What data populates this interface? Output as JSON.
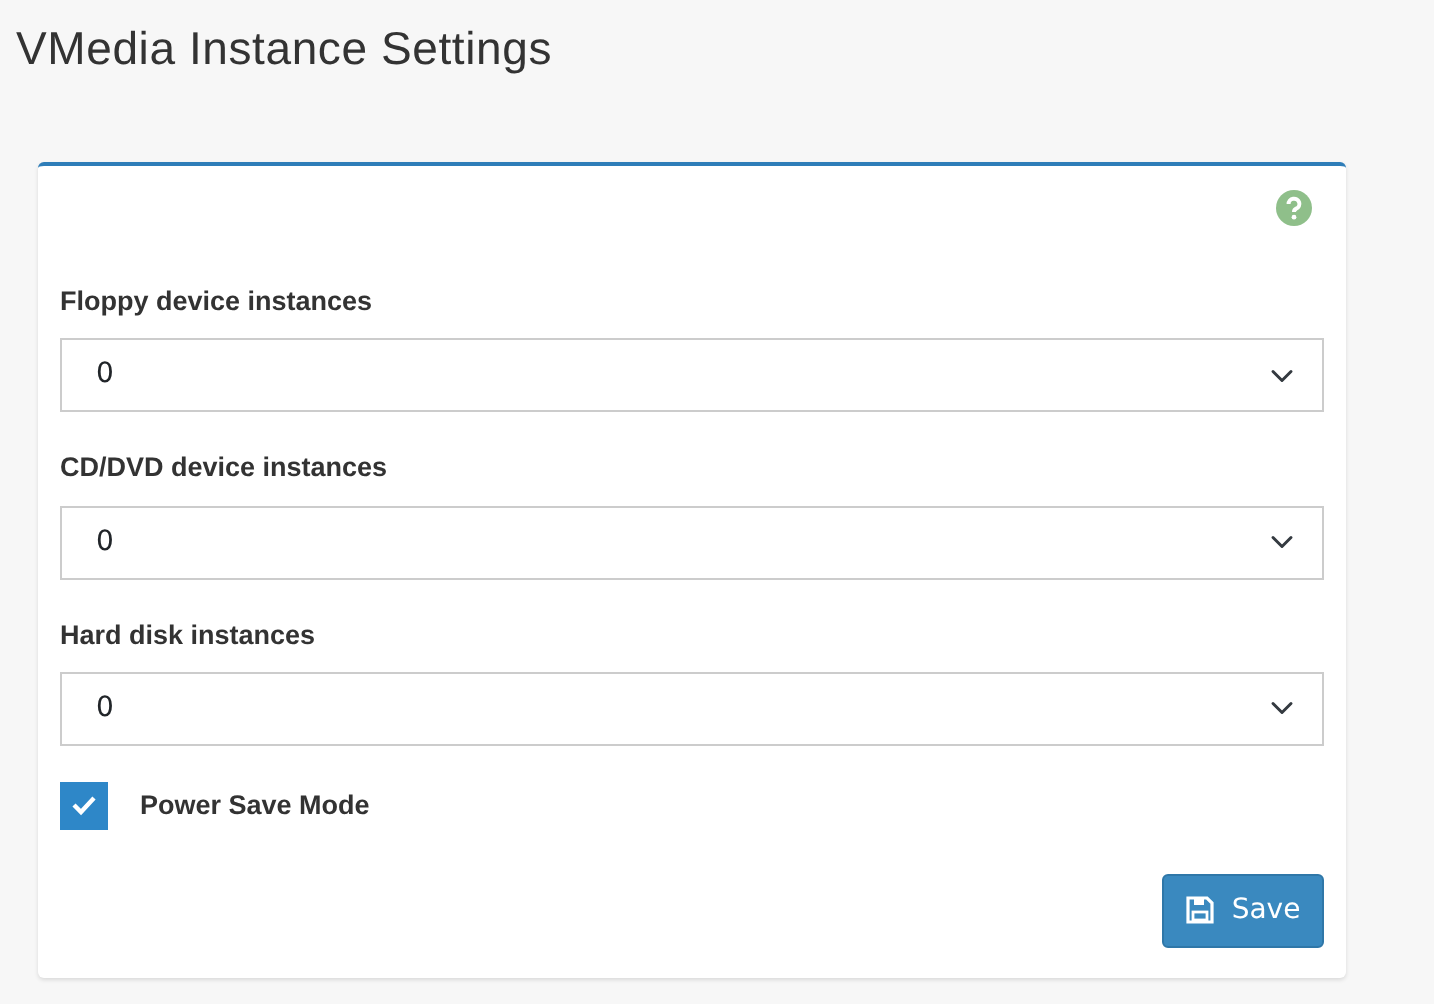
{
  "page": {
    "title": "VMedia Instance Settings"
  },
  "fields": [
    {
      "label": "Floppy device instances",
      "value": "0"
    },
    {
      "label": "CD/DVD device instances",
      "value": "0"
    },
    {
      "label": "Hard disk instances",
      "value": "0"
    }
  ],
  "power_save": {
    "label": "Power Save Mode",
    "checked": true
  },
  "save_button": {
    "label": "Save"
  }
}
